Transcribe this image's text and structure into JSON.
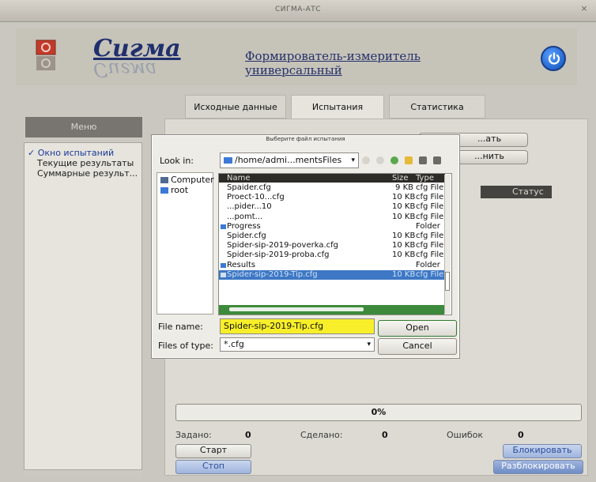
{
  "window": {
    "title": "СИГМА-АТС",
    "close_icon": "close-icon"
  },
  "header": {
    "logo_text": "Сигма",
    "logo_reflection": "Сигма",
    "subtitle": "Формирователь-измеритель универсальный",
    "power_icon": "power-icon"
  },
  "tabs": [
    {
      "label": "Исходные данные",
      "active": false
    },
    {
      "label": "Испытания",
      "active": true
    },
    {
      "label": "Статистика",
      "active": false
    }
  ],
  "menu": {
    "title": "Меню",
    "items": [
      {
        "label": "✓ Окно испытаний",
        "active": true
      },
      {
        "label": "Текущие результаты",
        "active": false
      },
      {
        "label": "Суммарные результ...",
        "active": false
      }
    ]
  },
  "content": {
    "hidden_button_1": "...ать",
    "hidden_button_2": "...нить",
    "status_header": "Статус",
    "progress_text": "0%",
    "counters": [
      {
        "label": "Задано:",
        "value": "0"
      },
      {
        "label": "Сделано:",
        "value": "0"
      },
      {
        "label": "Ошибок",
        "value": "0"
      }
    ],
    "start_button": "Старт",
    "stop_button": "Стоп",
    "block_button": "Блокировать",
    "unblock_button": "Разблокировать"
  },
  "dialog": {
    "title": "Выберите файл испытания",
    "look_in_label": "Look in:",
    "path": "/home/admi...mentsFiles",
    "places": [
      "Computer",
      "root"
    ],
    "columns": {
      "name": "Name",
      "size": "Size",
      "type": "Type"
    },
    "files": [
      {
        "name": "Spaider.cfg",
        "size": "9 KB",
        "type": "cfg File",
        "kind": "file",
        "selected": false
      },
      {
        "name": "Proect-10...cfg",
        "size": "10 KB",
        "type": "cfg File",
        "kind": "file",
        "selected": false
      },
      {
        "name": "...pider...10",
        "size": "10 KB",
        "type": "cfg File",
        "kind": "file",
        "selected": false
      },
      {
        "name": "...pomt...",
        "size": "10 KB",
        "type": "cfg File",
        "kind": "file",
        "selected": false
      },
      {
        "name": "Progress",
        "size": "",
        "type": "Folder",
        "kind": "folder",
        "selected": false
      },
      {
        "name": "Spider.cfg",
        "size": "10 KB",
        "type": "cfg File",
        "kind": "file",
        "selected": false
      },
      {
        "name": "Spider-sip-2019-poverka.cfg",
        "size": "10 KB",
        "type": "cfg File",
        "kind": "file",
        "selected": false
      },
      {
        "name": "Spider-sip-2019-proba.cfg",
        "size": "10 KB",
        "type": "cfg File",
        "kind": "file",
        "selected": false
      },
      {
        "name": "Results",
        "size": "",
        "type": "Folder",
        "kind": "folder",
        "selected": false
      },
      {
        "name": "Spider-sip-2019-Tip.cfg",
        "size": "10 KB",
        "type": "cfg File",
        "kind": "file",
        "selected": true
      }
    ],
    "file_name_label": "File name:",
    "file_name_value": "Spider-sip-2019-Tip.cfg",
    "files_of_type_label": "Files of type:",
    "files_of_type_value": "*.cfg",
    "open_button": "Open",
    "cancel_button": "Cancel"
  }
}
